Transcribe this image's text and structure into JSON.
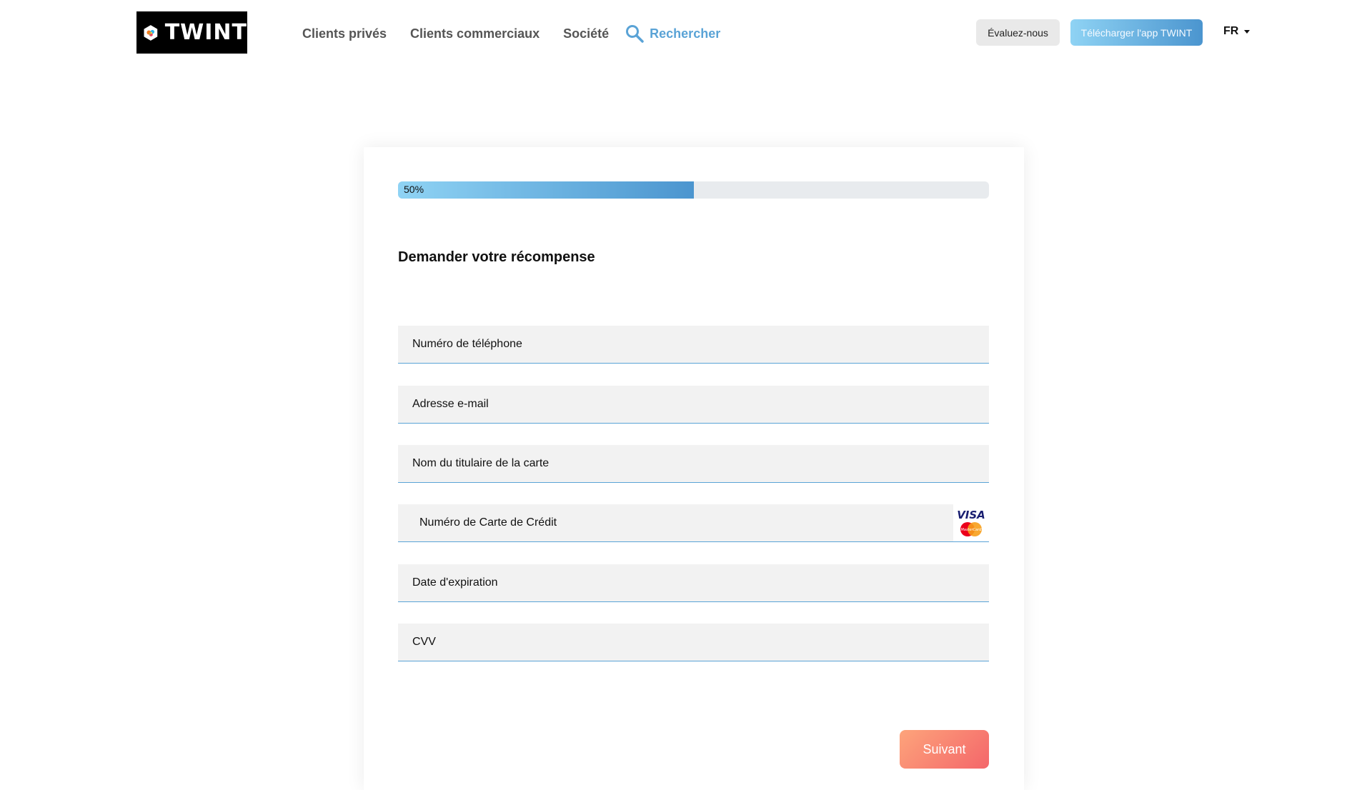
{
  "header": {
    "logo_text": "TWINT",
    "nav": [
      "Clients privés",
      "Clients commerciaux",
      "Société"
    ],
    "search_label": "Rechercher",
    "rate_button": "Évaluez-nous",
    "download_button": "Télécharger l'app TWINT",
    "language": "FR"
  },
  "progress": {
    "label": "50%",
    "fraction": 0.5
  },
  "form": {
    "title": "Demander votre récompense",
    "fields": {
      "phone": "Numéro de téléphone",
      "email": "Adresse e-mail",
      "cardholder": "Nom du titulaire de la carte",
      "card_number": "Numéro de Carte de Crédit",
      "expiry": "Date d'expiration",
      "cvv": "CVV"
    },
    "card_brand_visa": "VISA",
    "card_brand_mc": "MasterCard",
    "next_button": "Suivant"
  },
  "colors": {
    "accent_blue": "#5aa3d6",
    "gradient_start": "#8fd3f4",
    "gradient_end": "#4b95cf",
    "button_orange": "#fda47b",
    "button_red": "#f4666a"
  }
}
